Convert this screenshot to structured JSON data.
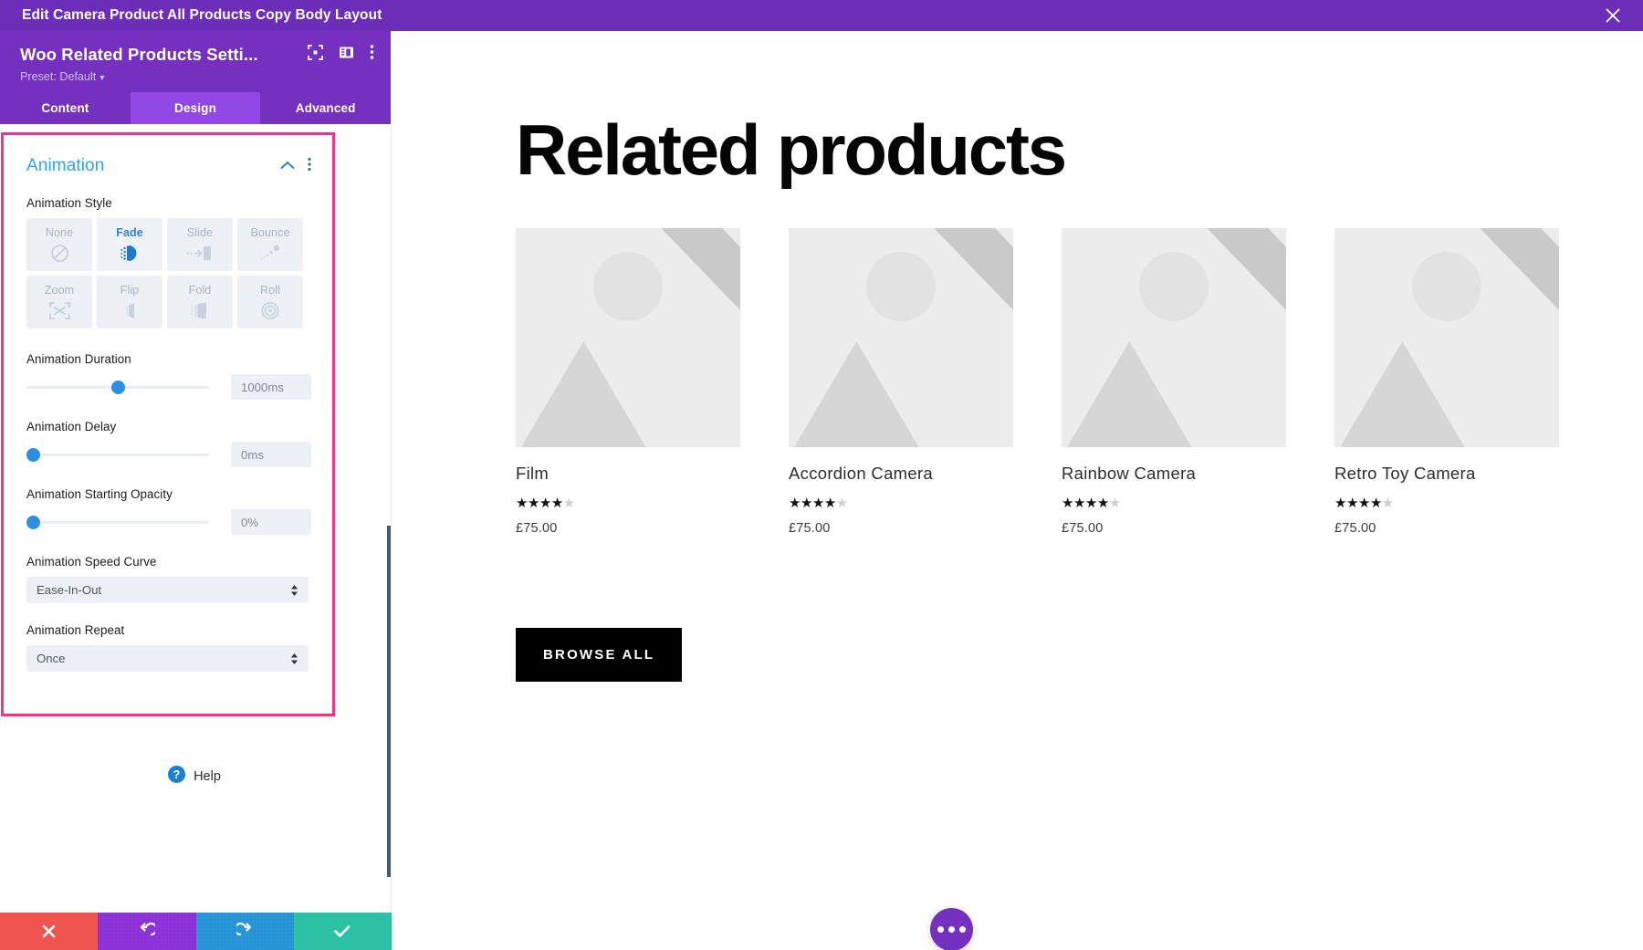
{
  "topbar": {
    "title": "Edit Camera Product All Products Copy Body Layout",
    "close_icon": "close-icon"
  },
  "panel": {
    "title": "Woo Related Products Setti...",
    "preset_label": "Preset: Default",
    "icons": [
      "fullscreen-icon",
      "layout-columns-icon",
      "kebab-menu-icon"
    ],
    "tabs": [
      {
        "label": "Content",
        "active": false
      },
      {
        "label": "Design",
        "active": true
      },
      {
        "label": "Advanced",
        "active": false
      }
    ],
    "section": {
      "title": "Animation",
      "collapse_icon": "chevron-up-icon",
      "menu_icon": "kebab-menu-icon"
    },
    "fields": {
      "animation_style_label": "Animation Style",
      "animation_styles": [
        {
          "label": "None",
          "icon": "no-entry-icon",
          "selected": false
        },
        {
          "label": "Fade",
          "icon": "fade-icon",
          "selected": true
        },
        {
          "label": "Slide",
          "icon": "slide-icon",
          "selected": false
        },
        {
          "label": "Bounce",
          "icon": "bounce-icon",
          "selected": false
        },
        {
          "label": "Zoom",
          "icon": "zoom-icon",
          "selected": false
        },
        {
          "label": "Flip",
          "icon": "flip-icon",
          "selected": false
        },
        {
          "label": "Fold",
          "icon": "fold-icon",
          "selected": false
        },
        {
          "label": "Roll",
          "icon": "roll-icon",
          "selected": false
        }
      ],
      "duration_label": "Animation Duration",
      "duration_value": "1000ms",
      "duration_percent": 50,
      "delay_label": "Animation Delay",
      "delay_value": "0ms",
      "delay_percent": 0,
      "opacity_label": "Animation Starting Opacity",
      "opacity_value": "0%",
      "opacity_percent": 0,
      "speed_curve_label": "Animation Speed Curve",
      "speed_curve_value": "Ease-In-Out",
      "repeat_label": "Animation Repeat",
      "repeat_value": "Once"
    },
    "help_label": "Help",
    "actions": [
      {
        "name": "discard-button",
        "icon": "x-icon"
      },
      {
        "name": "undo-button",
        "icon": "undo-icon"
      },
      {
        "name": "redo-button",
        "icon": "redo-icon"
      },
      {
        "name": "save-button",
        "icon": "check-icon"
      }
    ]
  },
  "preview": {
    "heading": "Related products",
    "products": [
      {
        "name": "Film",
        "price": "£75.00",
        "rating_filled": 4,
        "rating_total": 5
      },
      {
        "name": "Accordion Camera",
        "price": "£75.00",
        "rating_filled": 4,
        "rating_total": 5
      },
      {
        "name": "Rainbow Camera",
        "price": "£75.00",
        "rating_filled": 4,
        "rating_total": 5
      },
      {
        "name": "Retro Toy Camera",
        "price": "£75.00",
        "rating_filled": 4,
        "rating_total": 5
      }
    ],
    "browse_all_label": "BROWSE ALL",
    "fab_icon": "ellipsis-icon"
  },
  "colors": {
    "topbar_purple": "#6c2eb9",
    "panel_purple": "#7430bf",
    "tab_active_purple": "#9248e4",
    "accent_blue": "#2ea3f2",
    "highlight_pink": "#ff2d8c",
    "slider_blue": "#2a8fe0",
    "action_red": "#f0544f",
    "action_undo": "#8b32d8",
    "action_redo": "#2693d6",
    "action_save": "#2bc1a4"
  }
}
